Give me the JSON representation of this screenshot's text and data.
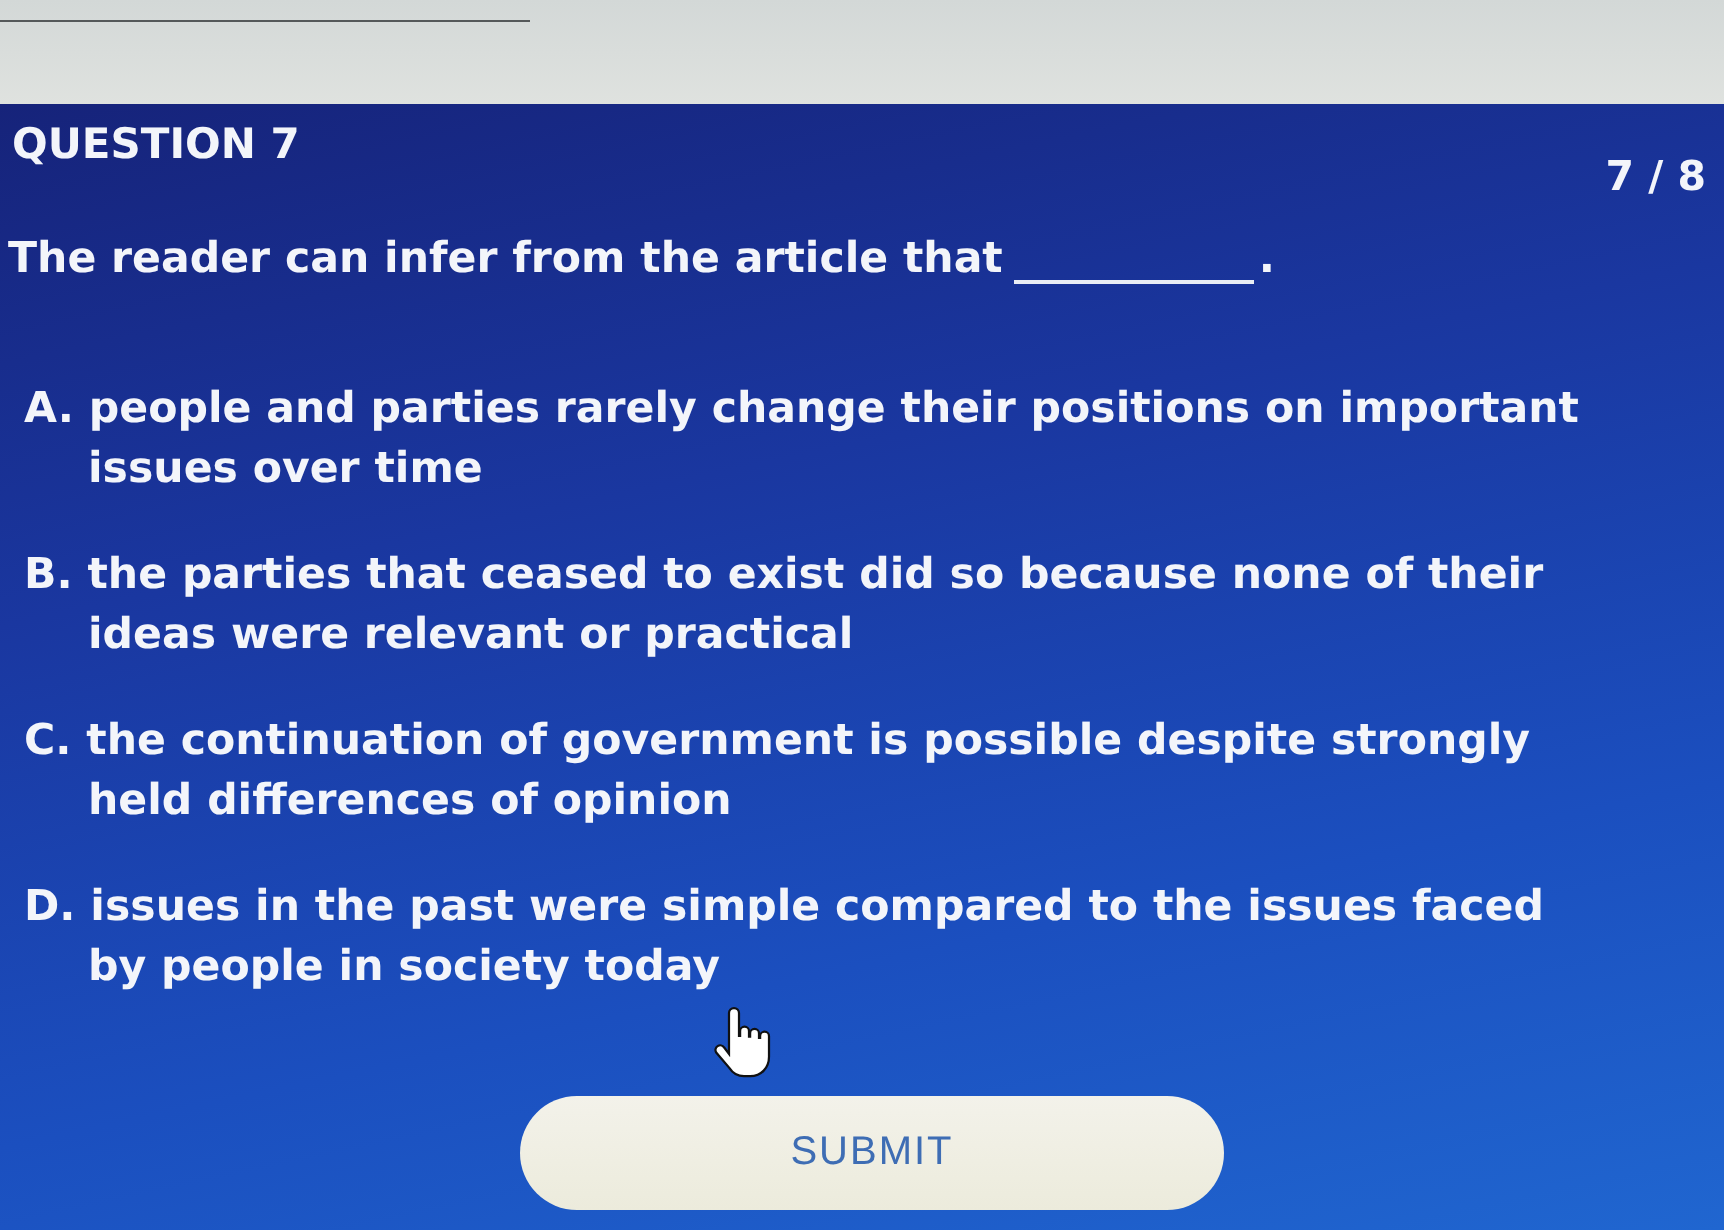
{
  "header": {
    "title": "QUESTION 7",
    "counter": "7 / 8"
  },
  "question": {
    "text": "The reader can infer from the article that",
    "ending": "."
  },
  "options": [
    {
      "letter": "A.",
      "text": "people and parties rarely change their positions on important issues over time",
      "selected": false
    },
    {
      "letter": "B.",
      "text": "the parties that ceased to exist did so because none of their ideas were relevant or practical",
      "selected": false
    },
    {
      "letter": "C.",
      "text": "the continuation of government is possible despite strongly held differences of opinion",
      "selected": false
    },
    {
      "letter": "D.",
      "text": "issues in the past were simple compared to the issues faced by people in society today",
      "selected": false
    }
  ],
  "submit_button": {
    "label": "SUBMIT"
  }
}
